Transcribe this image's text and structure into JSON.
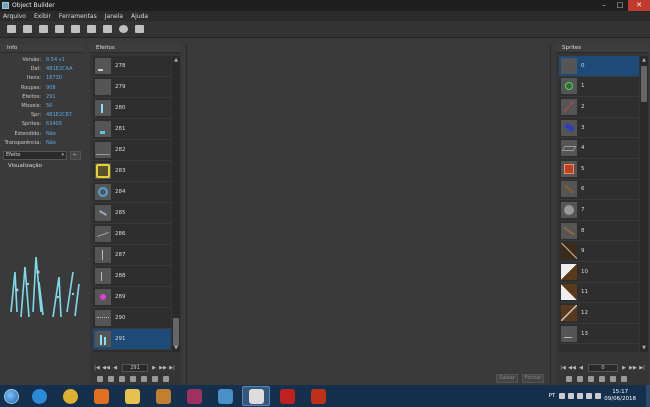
{
  "window": {
    "title": "Object Builder",
    "minimize": "–",
    "maximize": "□",
    "close": "✕"
  },
  "menu": [
    "Arquivo",
    "Exibir",
    "Ferramentas",
    "Janela",
    "Ajuda"
  ],
  "toolbar": [
    "new-icon",
    "open-icon",
    "compile-icon",
    "save-as-icon",
    "pages-icon",
    "find-icon",
    "import-icon",
    "animation-icon",
    "lookgenerator-icon"
  ],
  "info": {
    "title": "Info",
    "rows": [
      {
        "k": "Versão:",
        "v": "8.54 v1"
      },
      {
        "k": "Dat:",
        "v": "4B1E2CAA"
      },
      {
        "k": "Itens:",
        "v": "18730"
      },
      {
        "k": "Roupas:",
        "v": "908"
      },
      {
        "k": "Efeitos:",
        "v": "291"
      },
      {
        "k": "Mísseis:",
        "v": "56"
      },
      {
        "k": "Spr:",
        "v": "4B1E2C87"
      },
      {
        "k": "Sprites:",
        "v": "63406"
      },
      {
        "k": "Estendido:",
        "v": "Não"
      },
      {
        "k": "Transparência:",
        "v": "Não"
      }
    ]
  },
  "effect_select": {
    "value": "Efeito",
    "arrow": "▾",
    "button": "⇤"
  },
  "visualization": {
    "label": "Visualização"
  },
  "effects": {
    "title": "Efeitos",
    "items": [
      "278",
      "279",
      "280",
      "281",
      "282",
      "283",
      "284",
      "285",
      "286",
      "287",
      "288",
      "289",
      "290",
      "291"
    ],
    "selected": "291",
    "page_value": "291"
  },
  "actions": {
    "save": "Salvar",
    "close": "Fechar"
  },
  "sprites": {
    "title": "Sprites",
    "items": [
      "0",
      "1",
      "2",
      "3",
      "4",
      "5",
      "6",
      "7",
      "8",
      "9",
      "10",
      "11",
      "12",
      "13"
    ],
    "selected": "0",
    "page_value": "0"
  },
  "pager_glyphs": {
    "first": "|◀",
    "prev2": "◀◀",
    "prev": "◀",
    "next": "▶",
    "next2": "▶▶",
    "last": "▶|"
  },
  "scroll_glyphs": {
    "up": "▲",
    "down": "▼"
  },
  "taskbar": {
    "apps": [
      "ie-icon",
      "chrome-icon",
      "media-player-icon",
      "explorer-icon",
      "game-icon",
      "winrar-icon",
      "book-icon",
      "object-builder-icon",
      "adobe-icon",
      "flash-icon"
    ],
    "lang": "PT",
    "time": "15:17",
    "date": "09/06/2018"
  },
  "colors": {
    "accent": "#1e4a78",
    "info_value": "#5aa9e6",
    "taskbar": "#15304d"
  }
}
